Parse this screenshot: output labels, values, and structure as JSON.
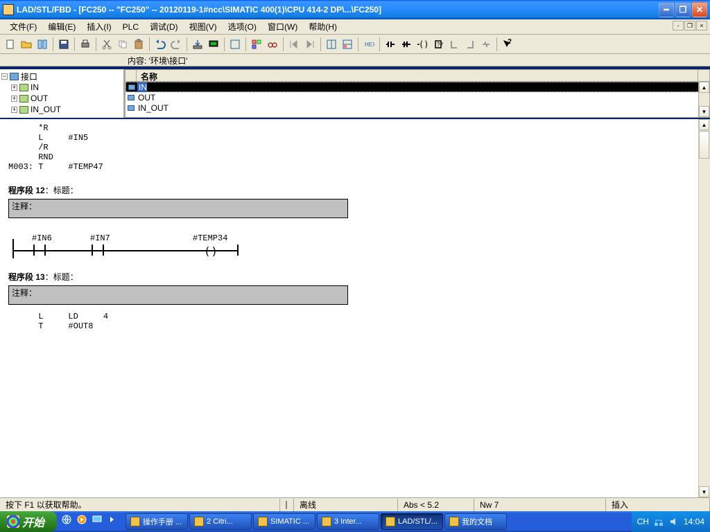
{
  "titlebar": {
    "text": "LAD/STL/FBD  - [FC250 -- \"FC250\" -- 20120119-1#ncc\\SIMATIC 400(1)\\CPU 414-2 DP\\...\\FC250]"
  },
  "menu": {
    "file": "文件(F)",
    "edit": "编辑(E)",
    "insert": "插入(I)",
    "plc": "PLC",
    "debug": "调试(D)",
    "view": "视图(V)",
    "options": "选项(O)",
    "window": "窗口(W)",
    "help": "帮助(H)"
  },
  "label_strip": {
    "content": "内容:  '环境\\接口'"
  },
  "tree": {
    "root": "接口",
    "in": "IN",
    "out": "OUT",
    "inout": "IN_OUT"
  },
  "grid": {
    "header": "名称",
    "rows": [
      "IN",
      "OUT",
      "IN_OUT"
    ]
  },
  "code": {
    "stl1_l1": "      *R",
    "stl1_l2": "      L     #IN5",
    "stl1_l3": "      /R",
    "stl1_l4": "      RND",
    "stl1_l5": "M003: T     #TEMP47",
    "net12_title_a": "程序段 12",
    "net12_title_b": "：标题：",
    "comment12": "注释：",
    "contact1": "#IN6",
    "contact2": "#IN7",
    "coil1": "#TEMP34",
    "net13_title_a": "程序段 13",
    "net13_title_b": "：标题：",
    "comment13": "注释：",
    "stl2_l1": "      L     LD     4",
    "stl2_l2": "      T     #OUT8"
  },
  "statusbar": {
    "help": "按下 F1 以获取帮助。",
    "offline": "离线",
    "pos": "Abs < 5.2",
    "nw": "Nw 7",
    "insert": "插入"
  },
  "taskbar": {
    "start": "开始",
    "tasks": [
      {
        "label": "操作手册 ..."
      },
      {
        "label": "2 Citri..."
      },
      {
        "label": "SIMATIC ..."
      },
      {
        "label": "3 Inter..."
      },
      {
        "label": "LAD/STL/...",
        "active": true
      },
      {
        "label": "我的文档"
      }
    ],
    "lang": "CH",
    "clock": "14:04"
  }
}
